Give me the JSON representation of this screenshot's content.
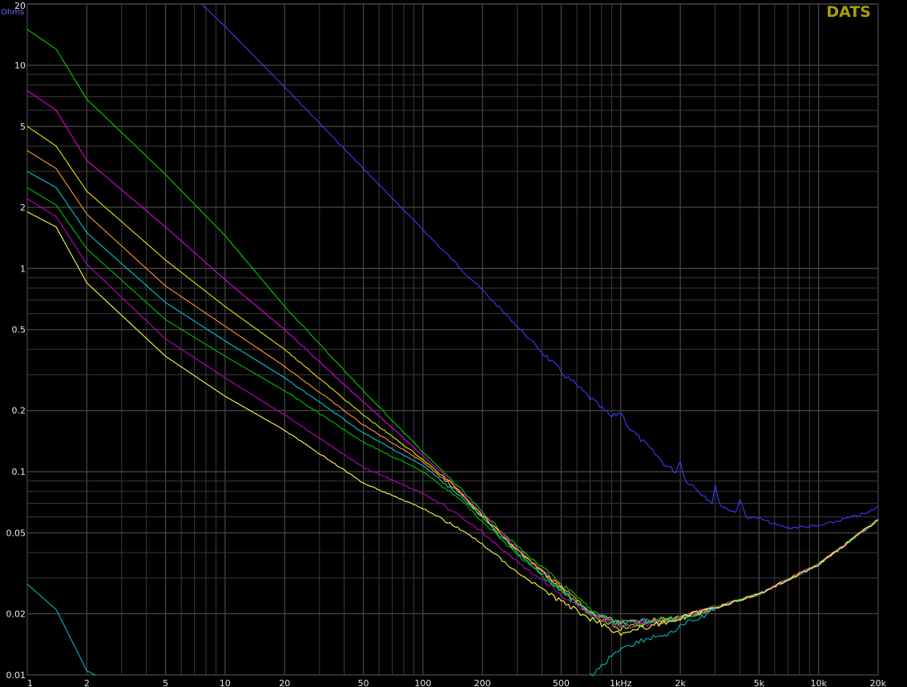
{
  "chart_data": {
    "type": "line",
    "title": "",
    "brand": "DATS",
    "ylabel": "Ohms",
    "xlabel": "",
    "x_scale": "log",
    "y_scale": "log",
    "xlim": [
      1,
      20000
    ],
    "ylim": [
      0.01,
      20
    ],
    "grid": true,
    "background": "#000000",
    "grid_color": "#3a3a3a",
    "x_ticks": [
      {
        "value": 1,
        "label": "1"
      },
      {
        "value": 2,
        "label": "2"
      },
      {
        "value": 5,
        "label": "5"
      },
      {
        "value": 10,
        "label": "10"
      },
      {
        "value": 20,
        "label": "20"
      },
      {
        "value": 50,
        "label": "50"
      },
      {
        "value": 100,
        "label": "100"
      },
      {
        "value": 200,
        "label": "200"
      },
      {
        "value": 500,
        "label": "500"
      },
      {
        "value": 1000,
        "label": "1kHz"
      },
      {
        "value": 2000,
        "label": "2k"
      },
      {
        "value": 5000,
        "label": "5k"
      },
      {
        "value": 10000,
        "label": "10k"
      },
      {
        "value": 20000,
        "label": "20k"
      }
    ],
    "y_ticks": [
      {
        "value": 20,
        "label": "20"
      },
      {
        "value": 10,
        "label": "10"
      },
      {
        "value": 5,
        "label": "5"
      },
      {
        "value": 2,
        "label": "2"
      },
      {
        "value": 1,
        "label": "1"
      },
      {
        "value": 0.5,
        "label": "0.5"
      },
      {
        "value": 0.2,
        "label": "0.2"
      },
      {
        "value": 0.1,
        "label": "0.1"
      },
      {
        "value": 0.05,
        "label": "0.05"
      },
      {
        "value": 0.02,
        "label": "0.02"
      },
      {
        "value": 0.01,
        "label": "0.01"
      }
    ],
    "series": [
      {
        "color": "#3b3bff",
        "x": [
          7.6,
          10,
          20,
          50,
          100,
          200,
          500,
          900,
          1000,
          1100,
          1300,
          1700,
          1900,
          2000,
          2100,
          2500,
          2900,
          3000,
          3200,
          3800,
          4000,
          4300,
          5000,
          6000,
          7000,
          10000,
          14000,
          18000,
          20000
        ],
        "y": [
          20,
          15.5,
          7.8,
          3.1,
          1.55,
          0.78,
          0.31,
          0.185,
          0.197,
          0.165,
          0.14,
          0.107,
          0.1,
          0.115,
          0.093,
          0.08,
          0.071,
          0.085,
          0.068,
          0.063,
          0.073,
          0.06,
          0.059,
          0.055,
          0.053,
          0.054,
          0.059,
          0.063,
          0.068
        ]
      },
      {
        "color": "#00d000",
        "x": [
          1,
          1.4,
          2,
          5,
          10,
          20,
          50,
          100,
          150,
          200,
          300,
          500,
          700,
          1000,
          2000,
          5000,
          10000,
          20000
        ],
        "y": [
          15,
          12,
          6.8,
          2.9,
          1.45,
          0.65,
          0.25,
          0.125,
          0.085,
          0.063,
          0.043,
          0.028,
          0.021,
          0.018,
          0.019,
          0.025,
          0.035,
          0.058
        ]
      },
      {
        "color": "#e000e0",
        "x": [
          1,
          1.4,
          2,
          5,
          10,
          20,
          50,
          100,
          150,
          200,
          300,
          500,
          700,
          1000,
          2000,
          5000,
          10000,
          20000
        ],
        "y": [
          7.5,
          6,
          3.4,
          1.6,
          0.88,
          0.5,
          0.22,
          0.12,
          0.083,
          0.062,
          0.042,
          0.027,
          0.02,
          0.018,
          0.019,
          0.025,
          0.035,
          0.058
        ]
      },
      {
        "color": "#e6e600",
        "x": [
          1,
          1.4,
          2,
          5,
          10,
          20,
          50,
          100,
          150,
          200,
          300,
          500,
          700,
          1000,
          2000,
          5000,
          10000,
          20000
        ],
        "y": [
          5,
          4,
          2.4,
          1.1,
          0.65,
          0.4,
          0.19,
          0.115,
          0.082,
          0.061,
          0.041,
          0.027,
          0.02,
          0.017,
          0.019,
          0.025,
          0.035,
          0.058
        ]
      },
      {
        "color": "#ff9a2a",
        "x": [
          1,
          1.4,
          2,
          5,
          10,
          20,
          50,
          100,
          150,
          200,
          300,
          500,
          700,
          1000,
          2000,
          5000,
          10000,
          20000
        ],
        "y": [
          3.8,
          3.1,
          1.85,
          0.82,
          0.52,
          0.33,
          0.17,
          0.112,
          0.08,
          0.06,
          0.041,
          0.027,
          0.02,
          0.018,
          0.019,
          0.025,
          0.035,
          0.058
        ]
      },
      {
        "color": "#00c8d0",
        "x": [
          1,
          1.4,
          2,
          5,
          10,
          20,
          50,
          100,
          150,
          200,
          300,
          500,
          700,
          1000,
          2000,
          5000,
          10000,
          20000
        ],
        "y": [
          3,
          2.5,
          1.5,
          0.68,
          0.44,
          0.29,
          0.155,
          0.107,
          0.078,
          0.059,
          0.04,
          0.026,
          0.02,
          0.018,
          0.019,
          0.025,
          0.035,
          0.058
        ]
      },
      {
        "color": "#00c000",
        "x": [
          1,
          1.4,
          2,
          5,
          10,
          20,
          50,
          100,
          150,
          200,
          300,
          500,
          700,
          1000,
          2000,
          5000,
          10000,
          20000
        ],
        "y": [
          2.5,
          2.05,
          1.25,
          0.56,
          0.37,
          0.25,
          0.14,
          0.1,
          0.075,
          0.057,
          0.039,
          0.026,
          0.02,
          0.017,
          0.019,
          0.025,
          0.035,
          0.058
        ]
      },
      {
        "color": "#c000c0",
        "x": [
          1,
          1.4,
          2,
          5,
          10,
          20,
          50,
          100,
          150,
          200,
          300,
          500,
          700,
          1000,
          2000,
          5000,
          10000,
          20000
        ],
        "y": [
          2.2,
          1.8,
          1.05,
          0.45,
          0.29,
          0.19,
          0.105,
          0.078,
          0.062,
          0.05,
          0.036,
          0.025,
          0.02,
          0.017,
          0.019,
          0.025,
          0.035,
          0.058
        ]
      },
      {
        "color": "#ffff40",
        "x": [
          1,
          1.4,
          2,
          5,
          10,
          20,
          50,
          100,
          150,
          200,
          300,
          500,
          700,
          1000,
          2000,
          5000,
          10000,
          20000
        ],
        "y": [
          1.9,
          1.6,
          0.85,
          0.37,
          0.235,
          0.16,
          0.088,
          0.066,
          0.053,
          0.044,
          0.032,
          0.023,
          0.019,
          0.016,
          0.019,
          0.025,
          0.035,
          0.058
        ]
      },
      {
        "color": "#00b8c0",
        "x": [
          1,
          1.4,
          2,
          2.2
        ],
        "y": [
          0.028,
          0.021,
          0.0105,
          0.01
        ]
      },
      {
        "color": "#00b8c0",
        "x": [
          700,
          800,
          900,
          1000,
          1200,
          1500,
          1800,
          2000,
          2500,
          3000
        ],
        "y": [
          0.01,
          0.011,
          0.0125,
          0.0135,
          0.0145,
          0.0155,
          0.016,
          0.0175,
          0.019,
          0.021
        ]
      }
    ]
  }
}
